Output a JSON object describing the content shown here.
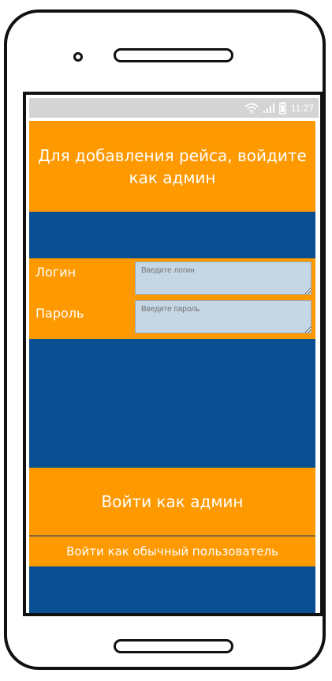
{
  "status_bar": {
    "time": "11:27",
    "icons": [
      "wifi-icon",
      "signal-icon",
      "battery-icon"
    ]
  },
  "screen": {
    "title": "Для добавления рейса, войдите как админ",
    "form": {
      "login_label": "Логин",
      "login_placeholder": "Введите логин",
      "password_label": "Пароль",
      "password_placeholder": "Введите пароль"
    },
    "buttons": {
      "admin_login": "Войти как админ",
      "user_login": "Войти как обычный пользователь"
    }
  },
  "colors": {
    "primary_orange": "#ff9900",
    "background_blue": "#0a4f91",
    "input_fill": "#c5d6e4",
    "status_bar_gray": "#d4d4d4"
  }
}
